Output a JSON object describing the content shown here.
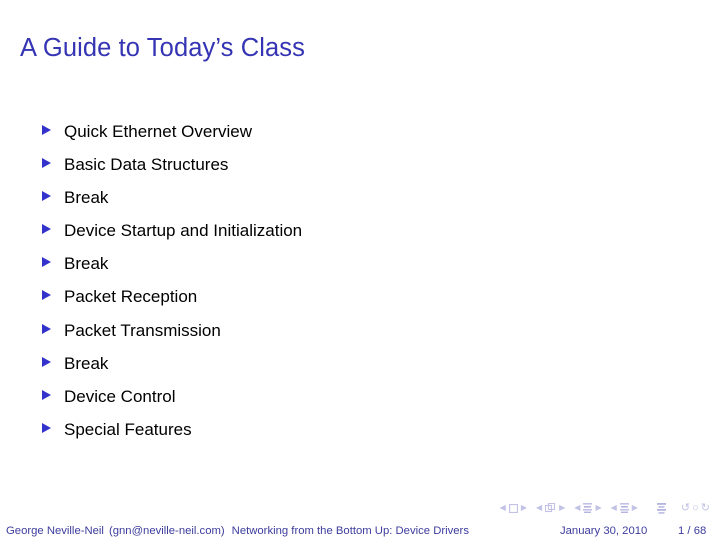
{
  "slide": {
    "title": "A Guide to Today’s Class",
    "items": [
      {
        "label": "Quick Ethernet Overview"
      },
      {
        "label": "Basic Data Structures"
      },
      {
        "label": "Break"
      },
      {
        "label": "Device Startup and Initialization"
      },
      {
        "label": "Break"
      },
      {
        "label": "Packet Reception"
      },
      {
        "label": "Packet Transmission"
      },
      {
        "label": "Break"
      },
      {
        "label": "Device Control"
      },
      {
        "label": "Special Features"
      }
    ]
  },
  "navigation": {
    "groups": [
      {
        "icon": "slide-square-icon",
        "prev": "◀",
        "next": "▶"
      },
      {
        "icon": "frames-stack-icon",
        "prev": "◀",
        "next": "▶"
      },
      {
        "icon": "subsection-lines-icon",
        "prev": "◀",
        "next": "▶"
      },
      {
        "icon": "section-lines-icon",
        "prev": "◀",
        "next": "▶"
      }
    ],
    "doc_icon": "document-lines-icon",
    "back_icon": "↺",
    "find_icon": "○",
    "forward_icon": "↻"
  },
  "footer": {
    "author": "George Neville-Neil",
    "email": "(gnn@neville-neil.com)",
    "presentation_title": "Networking from the Bottom Up: Device Drivers",
    "date": "January 30, 2010",
    "page": "1 / 68"
  },
  "colors": {
    "title": "#3434b4",
    "bullet": "#3333cc",
    "body_text": "#000000",
    "footer_text": "#3c3c9e",
    "nav_icon": "#c2c2e6",
    "background": "#ffffff"
  }
}
